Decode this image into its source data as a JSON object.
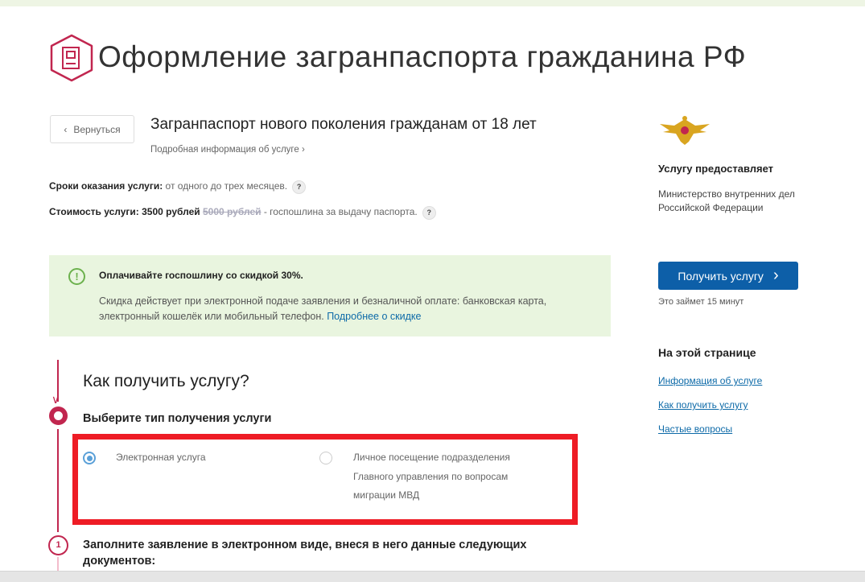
{
  "page": {
    "title": "Оформление загранпаспорта гражданина РФ"
  },
  "header": {
    "back_label": "Вернуться",
    "service_name": "Загранпаспорт нового поколения гражданам от 18 лет",
    "more_info": "Подробная информация об услуге"
  },
  "terms": {
    "label": "Сроки оказания услуги:",
    "value": "от одного до трех месяцев."
  },
  "cost": {
    "label": "Стоимость услуги: 3500 рублей",
    "old_price": "5000 рублей",
    "note": "- госпошлина за выдачу паспорта."
  },
  "promo": {
    "heading": "Оплачивайте госпошлину со скидкой 30%.",
    "text": "Скидка действует при электронной подаче заявления и безналичной оплате: банковская карта, электронный кошелёк или мобильный телефон.",
    "link": "Подробнее о скидке"
  },
  "how": {
    "heading": "Как получить услугу?",
    "step_choose": "Выберите тип получения услуги",
    "options": [
      {
        "label": "Электронная услуга",
        "selected": true
      },
      {
        "label": "Личное посещение подразделения Главного управления по вопросам миграции МВД",
        "selected": false
      }
    ],
    "step1_number": "1",
    "step1": "Заполните заявление в электронном виде, внеся в него данные следующих документов:"
  },
  "sidebar": {
    "provider_heading": "Услугу предоставляет",
    "provider": "Министерство внутренних дел Российской Федерации",
    "get_button": "Получить услугу",
    "duration": "Это займет 15 минут",
    "on_page_heading": "На этой странице",
    "links": [
      "Информация об услуге",
      "Как получить услугу",
      "Частые вопросы"
    ]
  }
}
